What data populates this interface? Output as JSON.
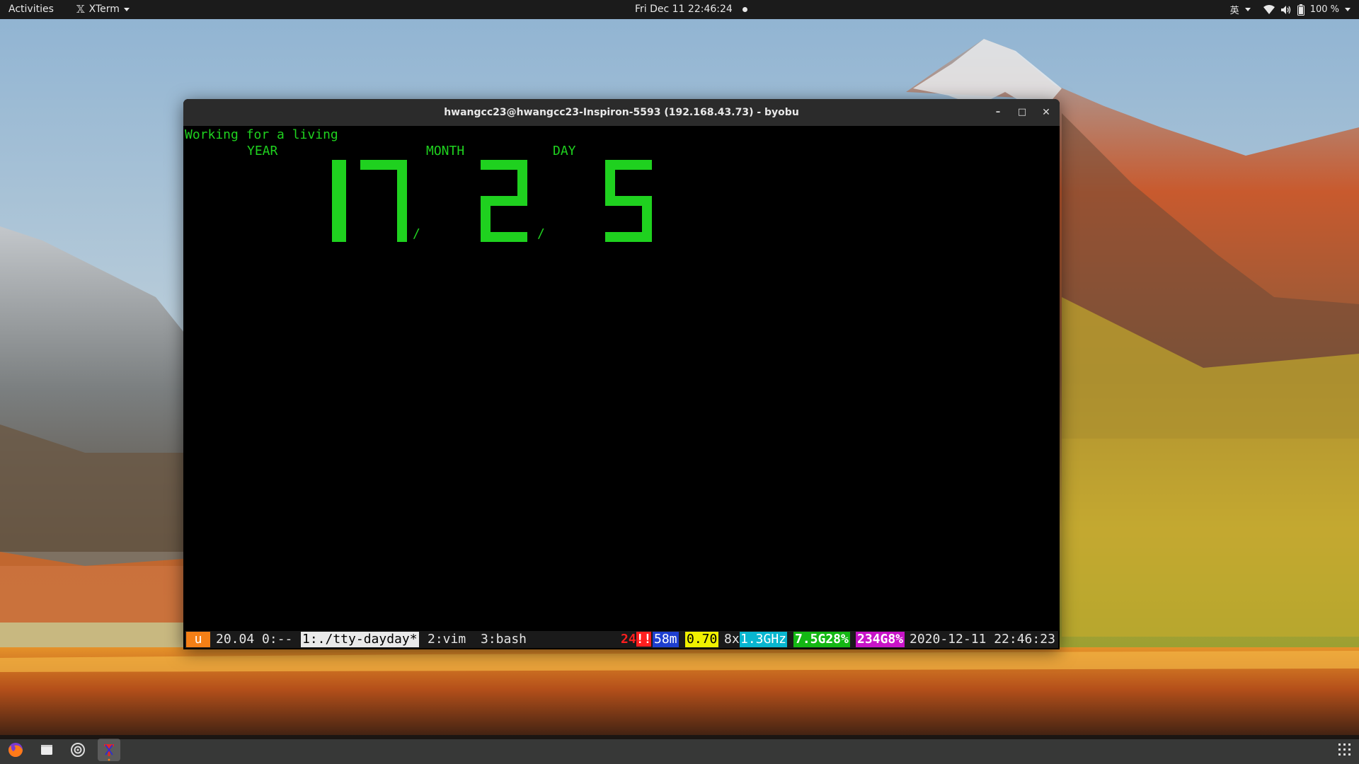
{
  "topbar": {
    "activities": "Activities",
    "app_name": "XTerm",
    "clock": "Fri Dec 11  22:46:24",
    "input_method": "英",
    "battery": "100 %"
  },
  "window": {
    "title": "hwangcc23@hwangcc23-Inspiron-5593 (192.168.43.73) - byobu",
    "min_glyph": "–",
    "max_glyph": "□",
    "close_glyph": "✕"
  },
  "terminal": {
    "line1": "Working for a living",
    "year_label": "YEAR",
    "month_label": "MONTH",
    "day_label": "DAY",
    "year_value": "17",
    "month_value": "2",
    "day_value": "5",
    "separator": "/"
  },
  "statusbar": {
    "logo": "u",
    "release": "20.04 0:--",
    "windows": [
      "1:./tty-dayday*",
      "2:vim",
      "3:bash"
    ],
    "updates": "24",
    "updates_mark": "!!",
    "uptime": "58m",
    "load": "0.70",
    "cpu_count": "8x",
    "cpu_freq": "1.3GHz",
    "memory": "7.5G28%",
    "disk": "234G8%",
    "datetime": "2020-12-11 22:46:23"
  },
  "dock": {
    "apps": [
      "firefox-icon",
      "files-icon",
      "rhythmbox-icon",
      "xterm-icon"
    ],
    "active_app": "xterm-icon"
  },
  "colors": {
    "terminal_green": "#1fd11f",
    "byobu_orange": "#f47f16",
    "updates_red": "#ff1f1f",
    "uptime_blue": "#1e3fd0",
    "load_yellow": "#f0f000",
    "cpu_cyan": "#08b6d0",
    "mem_green": "#14b814",
    "disk_magenta": "#c814c8"
  }
}
